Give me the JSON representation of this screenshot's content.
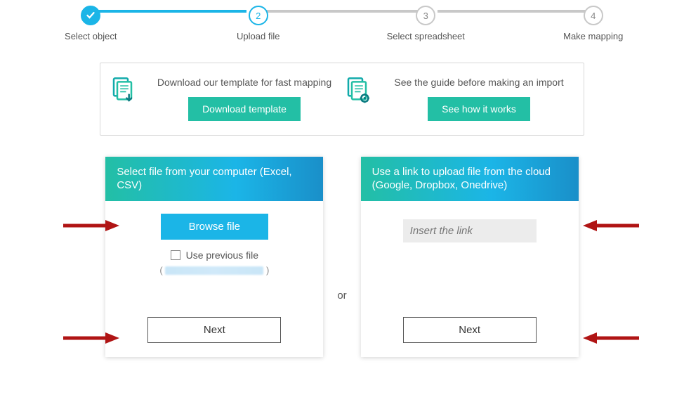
{
  "stepper": {
    "steps": [
      {
        "num": "✓",
        "label": "Select object",
        "state": "done"
      },
      {
        "num": "2",
        "label": "Upload file",
        "state": "current"
      },
      {
        "num": "3",
        "label": "Select spreadsheet",
        "state": "pending"
      },
      {
        "num": "4",
        "label": "Make mapping",
        "state": "pending"
      }
    ]
  },
  "info": {
    "left_text": "Download our template for fast mapping",
    "left_button": "Download template",
    "right_text": "See the guide before making an import",
    "right_button": "See how it works"
  },
  "card_left": {
    "header": "Select file from your computer (Excel, CSV)",
    "browse": "Browse file",
    "use_prev": "Use previous file",
    "next": "Next"
  },
  "card_right": {
    "header": "Use a link to upload file from the cloud (Google, Dropbox, Onedrive)",
    "placeholder": "Insert the link",
    "next": "Next"
  },
  "separator": "or"
}
